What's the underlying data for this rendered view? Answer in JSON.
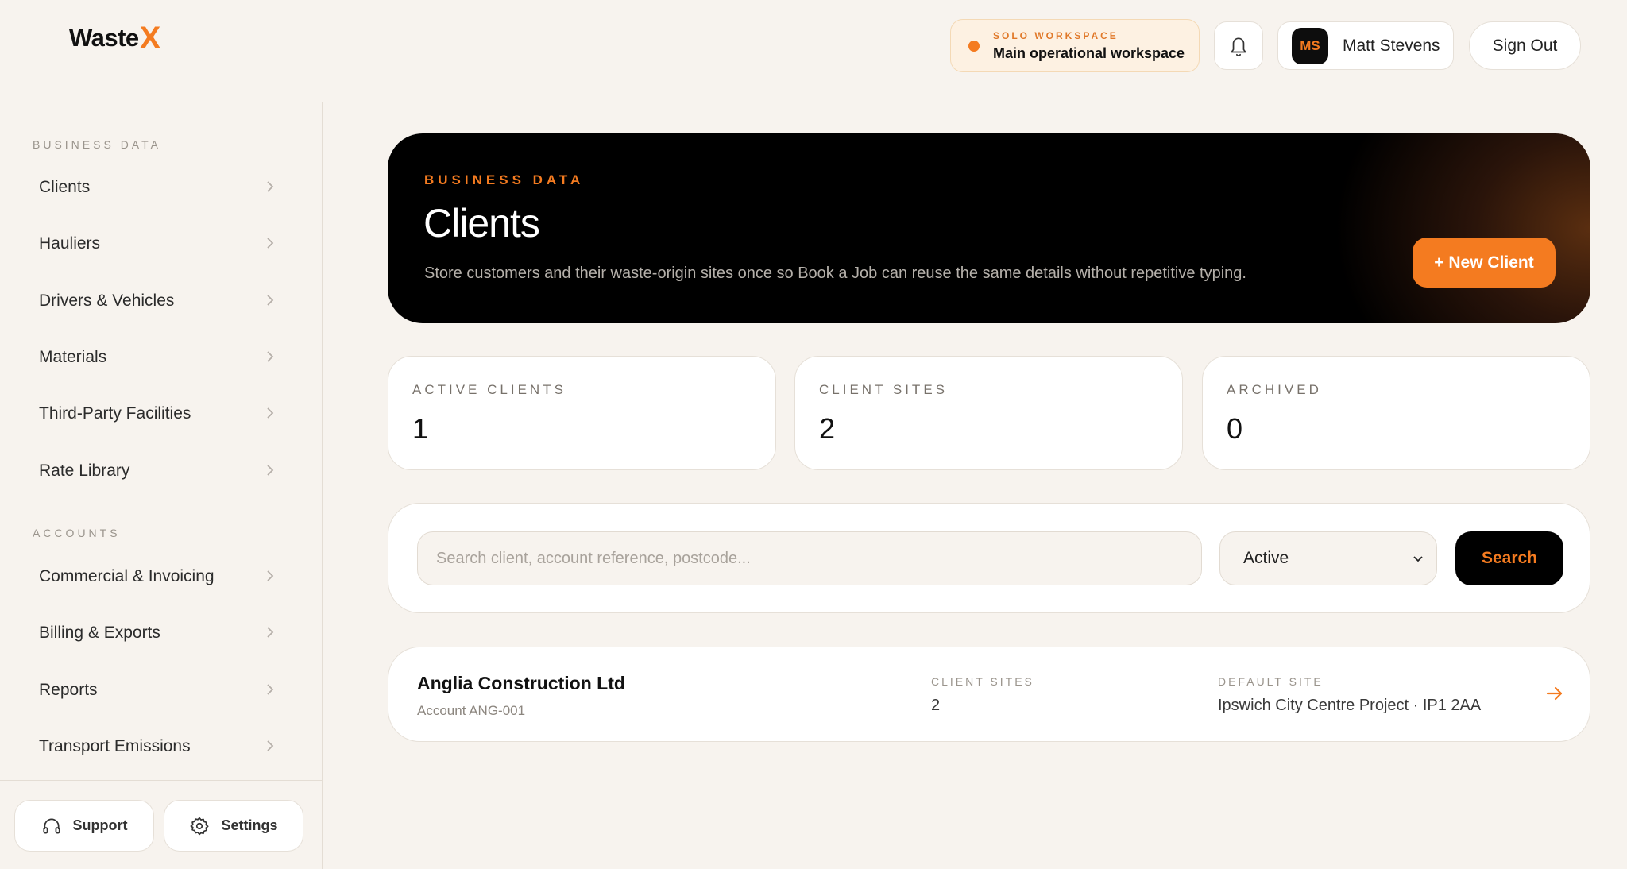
{
  "brand": {
    "name": "Waste",
    "mark": "X",
    "accent": "#f47b20"
  },
  "header": {
    "workspace_label": "SOLO WORKSPACE",
    "workspace_name": "Main operational workspace",
    "notifications_icon": "bell-icon",
    "user_initials": "MS",
    "user_name": "Matt Stevens",
    "sign_out_label": "Sign Out"
  },
  "sidebar": {
    "sections": [
      {
        "label": "BUSINESS DATA",
        "items": [
          {
            "label": "Clients"
          },
          {
            "label": "Hauliers"
          },
          {
            "label": "Drivers & Vehicles"
          },
          {
            "label": "Materials"
          },
          {
            "label": "Third-Party Facilities"
          },
          {
            "label": "Rate Library"
          }
        ]
      },
      {
        "label": "ACCOUNTS",
        "items": [
          {
            "label": "Commercial & Invoicing"
          },
          {
            "label": "Billing & Exports"
          },
          {
            "label": "Reports"
          },
          {
            "label": "Transport Emissions"
          }
        ]
      }
    ],
    "footer": {
      "support_label": "Support",
      "support_icon": "headphones-icon",
      "settings_label": "Settings",
      "settings_icon": "gear-icon"
    }
  },
  "hero": {
    "eyebrow": "BUSINESS DATA",
    "title": "Clients",
    "description": "Store customers and their waste-origin sites once so Book a Job can reuse the same details without repetitive typing.",
    "new_button_label": "+ New Client"
  },
  "stats": [
    {
      "label": "ACTIVE CLIENTS",
      "value": "1"
    },
    {
      "label": "CLIENT SITES",
      "value": "2"
    },
    {
      "label": "ARCHIVED",
      "value": "0"
    }
  ],
  "filters": {
    "search_placeholder": "Search client, account reference, postcode...",
    "search_value": "",
    "status_selected": "Active",
    "search_button_label": "Search"
  },
  "clients": [
    {
      "name": "Anglia Construction Ltd",
      "account": "Account ANG-001",
      "sites_label": "CLIENT SITES",
      "sites_value": "2",
      "default_site_label": "DEFAULT SITE",
      "default_site_value": "Ipswich City Centre Project · IP1 2AA"
    }
  ]
}
